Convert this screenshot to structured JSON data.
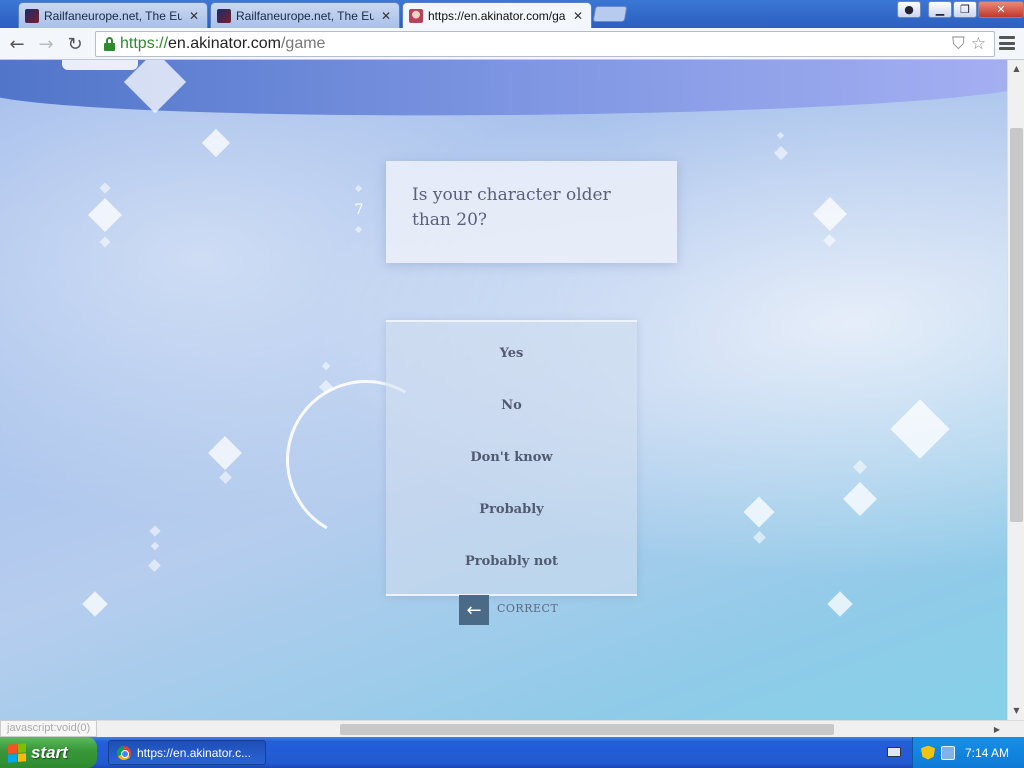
{
  "browser": {
    "tabs": [
      {
        "title": "Railfaneurope.net, The Europ",
        "active": false,
        "icon": "railfaneurope-favicon"
      },
      {
        "title": "Railfaneurope.net, The Europ",
        "active": false,
        "icon": "railfaneurope-favicon"
      },
      {
        "title": "https://en.akinator.com/game",
        "active": true,
        "icon": "akinator-favicon"
      }
    ],
    "close_glyph": "✕",
    "address": {
      "scheme": "https://",
      "host": "en.akinator.com",
      "path": "/game"
    }
  },
  "page": {
    "question_number": "7",
    "question": "Is your character older than 20?",
    "answers": [
      "Yes",
      "No",
      "Don't know",
      "Probably",
      "Probably not"
    ],
    "back_glyph": "←",
    "correct_label": "CORRECT"
  },
  "status_bar": {
    "text": "javascript:void(0)"
  },
  "taskbar": {
    "start_label": "start",
    "task_item": "https://en.akinator.c...",
    "clock": "7:14 AM"
  },
  "colors": {
    "accent_blue": "#4a6a86",
    "question_text": "#5a6078",
    "answer_text": "#525a70",
    "xp_green": "#3a9a3a",
    "xp_blue": "#245edb"
  }
}
